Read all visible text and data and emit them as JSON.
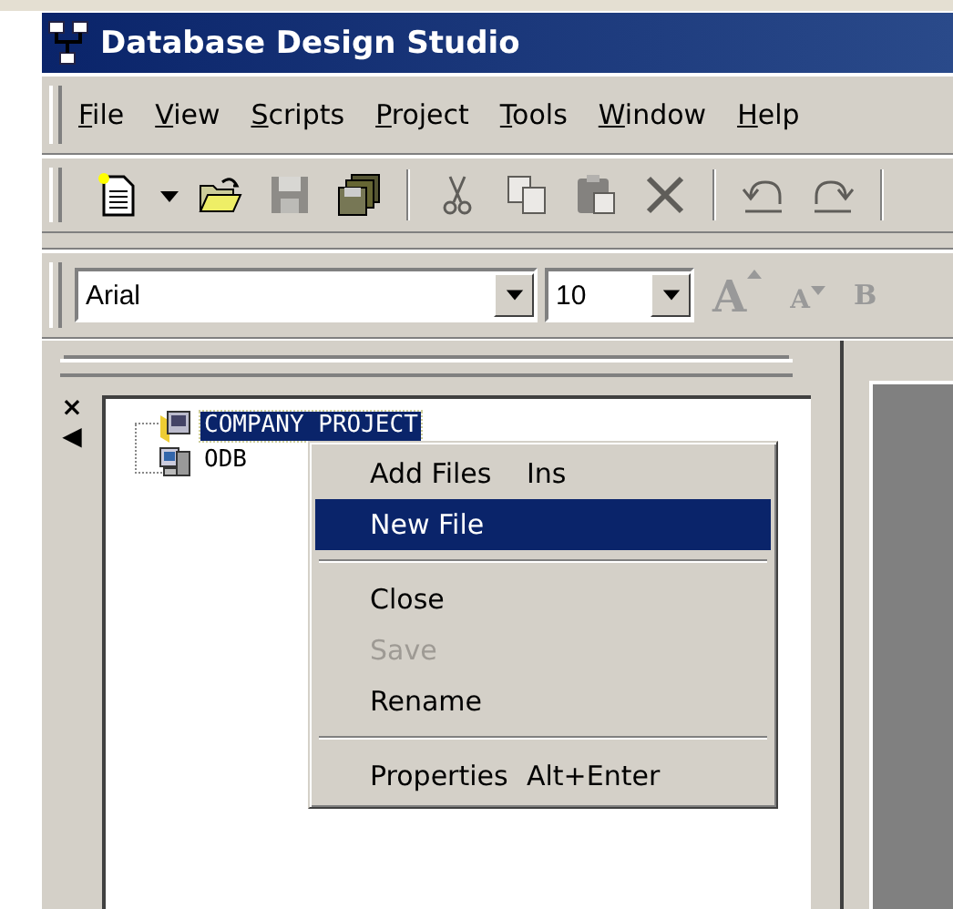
{
  "window": {
    "title": "Database Design Studio"
  },
  "menu_bar": [
    "File",
    "View",
    "Scripts",
    "Project",
    "Tools",
    "Window",
    "Help"
  ],
  "toolbar": [
    {
      "kind": "new",
      "disabled": false
    },
    {
      "kind": "dropdown",
      "disabled": false
    },
    {
      "kind": "open",
      "disabled": false
    },
    {
      "kind": "save",
      "disabled": true
    },
    {
      "kind": "save-all",
      "disabled": false
    },
    {
      "kind": "sep"
    },
    {
      "kind": "cut",
      "disabled": true
    },
    {
      "kind": "copy",
      "disabled": true
    },
    {
      "kind": "paste",
      "disabled": true
    },
    {
      "kind": "delete",
      "disabled": true
    },
    {
      "kind": "sep"
    },
    {
      "kind": "undo",
      "disabled": true
    },
    {
      "kind": "redo",
      "disabled": true
    },
    {
      "kind": "sep"
    }
  ],
  "format_bar": {
    "font": "Arial",
    "size": "10",
    "buttons": [
      {
        "kind": "grow",
        "label": "A",
        "disabled": true
      },
      {
        "kind": "shrink",
        "label": "A",
        "disabled": true
      },
      {
        "kind": "bold",
        "label": "B",
        "disabled": true
      }
    ]
  },
  "panel": {
    "close": "×",
    "collapse": "◀",
    "tree": [
      {
        "label": "COMPANY PROJECT",
        "kind": "project",
        "selected": true
      },
      {
        "label": "ODB",
        "kind": "database",
        "selected": false
      }
    ]
  },
  "context_menu": [
    {
      "kind": "item",
      "label": "Add Files",
      "shortcut": "Ins",
      "selected": false,
      "disabled": false
    },
    {
      "kind": "item",
      "label": "New File",
      "selected": true,
      "disabled": false
    },
    {
      "kind": "separator"
    },
    {
      "kind": "item",
      "label": "Close",
      "selected": false,
      "disabled": false
    },
    {
      "kind": "item",
      "label": "Save",
      "selected": false,
      "disabled": true
    },
    {
      "kind": "item",
      "label": "Rename",
      "selected": false,
      "disabled": false
    },
    {
      "kind": "separator"
    },
    {
      "kind": "item",
      "label": "Properties",
      "shortcut": "Alt+Enter",
      "selected": false,
      "disabled": false
    }
  ]
}
